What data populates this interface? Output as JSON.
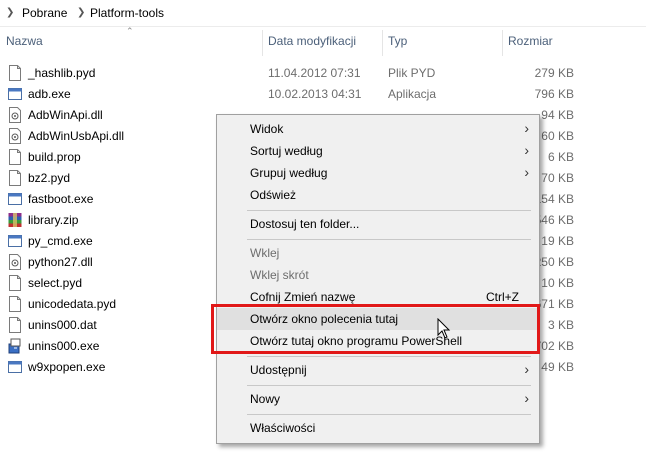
{
  "breadcrumb": {
    "segments": [
      "Pobrane",
      "Platform-tools"
    ]
  },
  "columns": {
    "name": "Nazwa",
    "date": "Data modyfikacji",
    "type": "Typ",
    "size": "Rozmiar"
  },
  "files": [
    {
      "name": "_hashlib.pyd",
      "date": "11.04.2012 07:31",
      "type": "Plik PYD",
      "size": "279 KB",
      "icon": "file-icon"
    },
    {
      "name": "adb.exe",
      "date": "10.02.2013 04:31",
      "type": "Aplikacja",
      "size": "796 KB",
      "icon": "exe-icon"
    },
    {
      "name": "AdbWinApi.dll",
      "date": "",
      "type": "",
      "size": "94 KB",
      "icon": "dll-icon"
    },
    {
      "name": "AdbWinUsbApi.dll",
      "date": "",
      "type": "",
      "size": "60 KB",
      "icon": "dll-icon"
    },
    {
      "name": "build.prop",
      "date": "",
      "type": "",
      "size": "6 KB",
      "icon": "file-icon"
    },
    {
      "name": "bz2.pyd",
      "date": "",
      "type": "",
      "size": "70 KB",
      "icon": "file-icon"
    },
    {
      "name": "fastboot.exe",
      "date": "",
      "type": "",
      "size": "154 KB",
      "icon": "exe-icon"
    },
    {
      "name": "library.zip",
      "date": "",
      "type": "",
      "size": "546 KB",
      "icon": "zip-icon"
    },
    {
      "name": "py_cmd.exe",
      "date": "",
      "type": "",
      "size": "19 KB",
      "icon": "exe-icon"
    },
    {
      "name": "python27.dll",
      "date": "",
      "type": "",
      "size": "250 KB",
      "icon": "dll-icon"
    },
    {
      "name": "select.pyd",
      "date": "",
      "type": "",
      "size": "10 KB",
      "icon": "file-icon"
    },
    {
      "name": "unicodedata.pyd",
      "date": "",
      "type": "",
      "size": "671 KB",
      "icon": "file-icon"
    },
    {
      "name": "unins000.dat",
      "date": "",
      "type": "",
      "size": "3 KB",
      "icon": "file-icon"
    },
    {
      "name": "unins000.exe",
      "date": "",
      "type": "",
      "size": "702 KB",
      "icon": "installer-icon"
    },
    {
      "name": "w9xpopen.exe",
      "date": "",
      "type": "",
      "size": "49 KB",
      "icon": "exe-icon"
    }
  ],
  "menu": {
    "view": "Widok",
    "sort_by": "Sortuj według",
    "group_by": "Grupuj według",
    "refresh": "Odśwież",
    "customize": "Dostosuj ten folder...",
    "paste": "Wklej",
    "paste_shortcut": "Wklej skrót",
    "undo_rename": "Cofnij Zmień nazwę",
    "undo_shortcut": "Ctrl+Z",
    "open_cmd": "Otwórz okno polecenia tutaj",
    "open_powershell": "Otwórz tutaj okno programu PowerShell",
    "share": "Udostępnij",
    "new": "Nowy",
    "properties": "Właściwości"
  },
  "colors": {
    "highlight_border": "#e11818",
    "header_text": "#4c607a",
    "menu_bg": "#f0f0f0"
  }
}
